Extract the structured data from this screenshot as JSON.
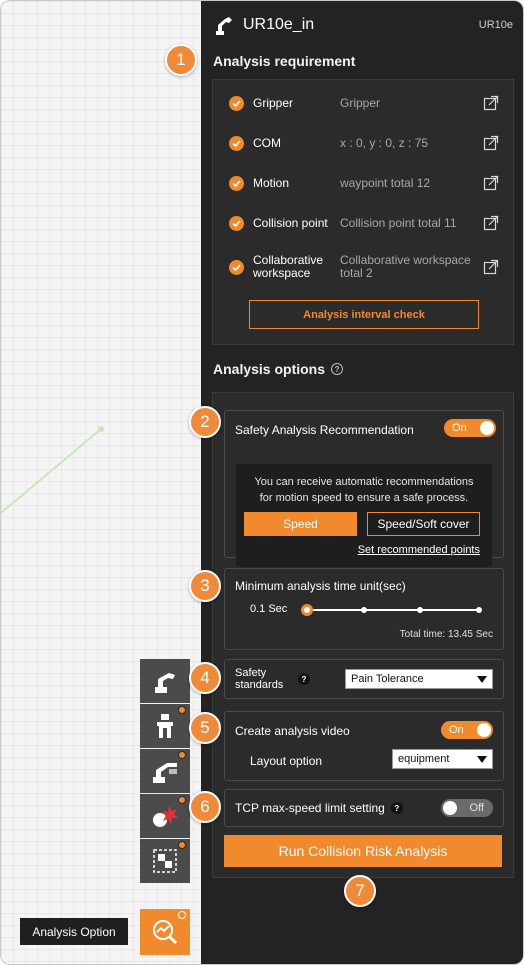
{
  "header": {
    "title": "UR10e_in",
    "model": "UR10e",
    "logo_icon": "robot-arm-icon"
  },
  "analysis_requirement": {
    "title": "Analysis requirement",
    "items": [
      {
        "label": "Gripper",
        "value": "Gripper",
        "checked": true
      },
      {
        "label": "COM",
        "value": "x : 0, y : 0, z : 75",
        "checked": true
      },
      {
        "label": "Motion",
        "value": "waypoint total 12",
        "checked": true
      },
      {
        "label": "Collision point",
        "value": "Collision point total 11",
        "checked": true
      },
      {
        "label": "Collaborative workspace",
        "value": "Collaborative workspace total 2",
        "checked": true
      }
    ],
    "interval_button": "Analysis interval check"
  },
  "analysis_options": {
    "title": "Analysis options",
    "help_icon": "question-circle-icon",
    "safety_recommendation": {
      "title": "Safety Analysis Recommendation",
      "toggle": "On",
      "description_line1": "You can receive automatic recommendations",
      "description_line2": "for motion speed to ensure a safe process.",
      "speed_button": "Speed",
      "soft_cover_button": "Speed/Soft cover",
      "set_points_link": "Set recommended points"
    },
    "time_unit": {
      "title": "Minimum analysis time unit(sec)",
      "value": "0.1 Sec",
      "slider_position": 0,
      "slider_stops": 4,
      "total_time": "Total time: 13.45 Sec"
    },
    "safety_standards": {
      "label_line1": "Safety",
      "label_line2": "standards",
      "selected": "Pain Tolerance"
    },
    "analysis_video": {
      "title": "Create analysis video",
      "toggle": "On",
      "layout_label": "Layout option",
      "layout_selected": "equipment"
    },
    "tcp_limit": {
      "title": "TCP max-speed limit setting",
      "toggle": "Off"
    },
    "run_button": "Run Collision Risk Analysis"
  },
  "callouts": [
    "1",
    "2",
    "3",
    "4",
    "5",
    "6",
    "7"
  ],
  "toolbar": {
    "tooltip": "Analysis Option",
    "tools": [
      {
        "icon": "robot-arm-icon",
        "badge": false
      },
      {
        "icon": "gripper-icon",
        "badge": true
      },
      {
        "icon": "robot-pose-icon",
        "badge": true
      },
      {
        "icon": "collision-point-icon",
        "badge": true
      },
      {
        "icon": "workspace-icon",
        "badge": true
      },
      {
        "icon": "analysis-option-icon",
        "badge": true,
        "active": true
      }
    ]
  },
  "colors": {
    "accent": "#f08a2c",
    "panel_bg": "#232323",
    "card_bg": "#2b2b2b",
    "toolbar_bg": "#4b4b4b",
    "badge": "#ef8a3a"
  }
}
